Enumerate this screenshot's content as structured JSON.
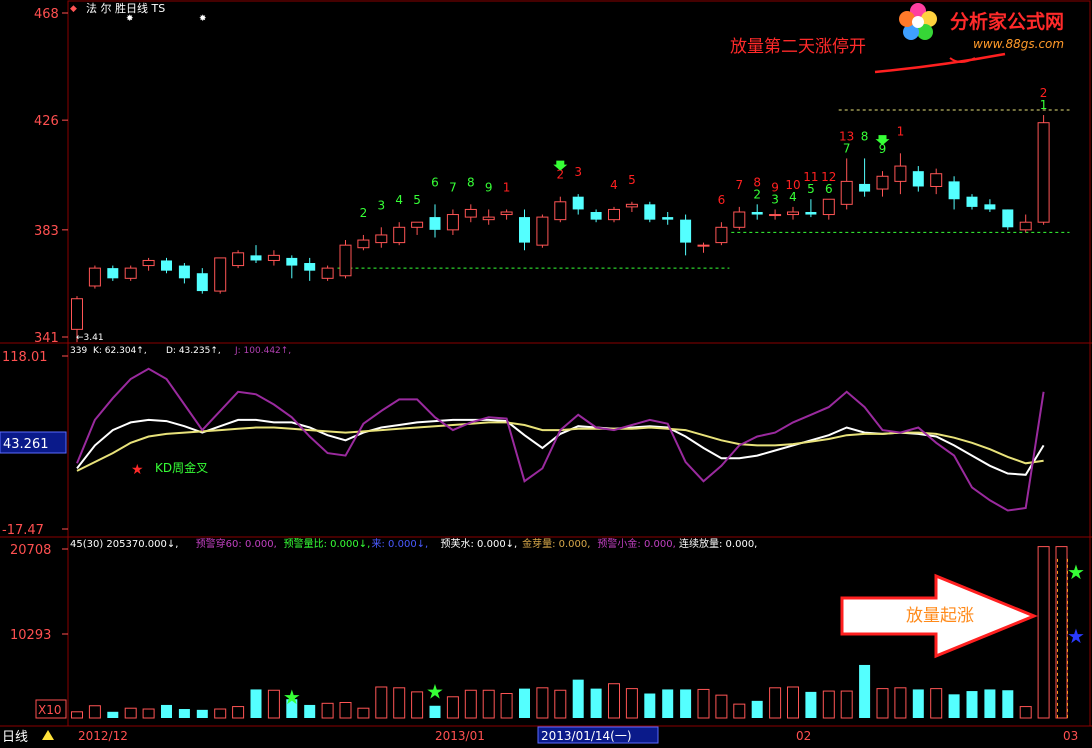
{
  "colors": {
    "up": "#ff5555",
    "down": "#54ffff",
    "white": "#ffffff",
    "yellow": "#e8e27a",
    "purple": "#9a2a9e",
    "green": "#36ff36",
    "red": "#ff2020",
    "grid": "#8a0000",
    "axis": "#ff5050"
  },
  "header": {
    "icon": "◆",
    "title": "法 尔 胜日线 TS"
  },
  "watermark": {
    "site": "分析家公式网",
    "url": "www.88gs.com"
  },
  "annotations": {
    "top_note": "放量第二天涨停开",
    "kd_note": "KD周金叉",
    "vol_note": "放量起涨"
  },
  "footer": {
    "period_label": "日线",
    "x_labels": [
      "2012/12",
      "2013/01",
      "2013/01/14(一)",
      "02",
      "03"
    ],
    "volume_scale": "X10"
  },
  "chart_data": [
    {
      "type": "candlestick",
      "panel": "price",
      "ylim": [
        341,
        468
      ],
      "yticks": [
        468,
        426,
        383,
        341
      ],
      "min_label": "←3.41",
      "candles": [
        {
          "o": 344,
          "h": 357,
          "l": 339,
          "c": 356
        },
        {
          "o": 361,
          "h": 369,
          "l": 360,
          "c": 368
        },
        {
          "o": 368,
          "h": 369,
          "l": 363,
          "c": 364
        },
        {
          "o": 364,
          "h": 369,
          "l": 363,
          "c": 368
        },
        {
          "o": 369,
          "h": 372,
          "l": 367,
          "c": 371
        },
        {
          "o": 371,
          "h": 372,
          "l": 366,
          "c": 367
        },
        {
          "o": 369,
          "h": 370,
          "l": 362,
          "c": 364
        },
        {
          "o": 366,
          "h": 368,
          "l": 358,
          "c": 359
        },
        {
          "o": 359,
          "h": 372,
          "l": 358,
          "c": 372
        },
        {
          "o": 369,
          "h": 375,
          "l": 368,
          "c": 374
        },
        {
          "o": 373,
          "h": 377,
          "l": 370,
          "c": 371
        },
        {
          "o": 371,
          "h": 375,
          "l": 369,
          "c": 373
        },
        {
          "o": 372,
          "h": 373,
          "l": 364,
          "c": 369
        },
        {
          "o": 370,
          "h": 372,
          "l": 363,
          "c": 367
        },
        {
          "o": 364,
          "h": 369,
          "l": 363,
          "c": 368
        },
        {
          "o": 365,
          "h": 379,
          "l": 364,
          "c": 377
        },
        {
          "o": 376,
          "h": 381,
          "l": 375,
          "c": 379
        },
        {
          "o": 378,
          "h": 384,
          "l": 376,
          "c": 381
        },
        {
          "o": 378,
          "h": 386,
          "l": 377,
          "c": 384
        },
        {
          "o": 384,
          "h": 386,
          "l": 381,
          "c": 386
        },
        {
          "o": 388,
          "h": 393,
          "l": 380,
          "c": 383
        },
        {
          "o": 383,
          "h": 391,
          "l": 381,
          "c": 389
        },
        {
          "o": 388,
          "h": 393,
          "l": 386,
          "c": 391
        },
        {
          "o": 387,
          "h": 391,
          "l": 385,
          "c": 388
        },
        {
          "o": 389,
          "h": 391,
          "l": 387,
          "c": 390
        },
        {
          "o": 388,
          "h": 391,
          "l": 375,
          "c": 378
        },
        {
          "o": 377,
          "h": 389,
          "l": 376,
          "c": 388
        },
        {
          "o": 387,
          "h": 396,
          "l": 386,
          "c": 394
        },
        {
          "o": 396,
          "h": 397,
          "l": 389,
          "c": 391
        },
        {
          "o": 390,
          "h": 391,
          "l": 386,
          "c": 387
        },
        {
          "o": 387,
          "h": 392,
          "l": 386,
          "c": 391
        },
        {
          "o": 392,
          "h": 394,
          "l": 390,
          "c": 393
        },
        {
          "o": 393,
          "h": 394,
          "l": 386,
          "c": 387
        },
        {
          "o": 388,
          "h": 390,
          "l": 385,
          "c": 387
        },
        {
          "o": 387,
          "h": 389,
          "l": 373,
          "c": 378
        },
        {
          "o": 377,
          "h": 378,
          "l": 374,
          "c": 377
        },
        {
          "o": 378,
          "h": 386,
          "l": 377,
          "c": 384
        },
        {
          "o": 384,
          "h": 392,
          "l": 383,
          "c": 390
        },
        {
          "o": 390,
          "h": 393,
          "l": 387,
          "c": 389
        },
        {
          "o": 389,
          "h": 391,
          "l": 387,
          "c": 389
        },
        {
          "o": 389,
          "h": 392,
          "l": 387,
          "c": 390
        },
        {
          "o": 390,
          "h": 395,
          "l": 388,
          "c": 389
        },
        {
          "o": 389,
          "h": 395,
          "l": 387,
          "c": 395
        },
        {
          "o": 393,
          "h": 411,
          "l": 391,
          "c": 402
        },
        {
          "o": 401,
          "h": 411,
          "l": 396,
          "c": 398
        },
        {
          "o": 399,
          "h": 406,
          "l": 396,
          "c": 404
        },
        {
          "o": 402,
          "h": 413,
          "l": 397,
          "c": 408
        },
        {
          "o": 406,
          "h": 408,
          "l": 398,
          "c": 400
        },
        {
          "o": 400,
          "h": 407,
          "l": 397,
          "c": 405
        },
        {
          "o": 402,
          "h": 404,
          "l": 391,
          "c": 395
        },
        {
          "o": 396,
          "h": 397,
          "l": 391,
          "c": 392
        },
        {
          "o": 393,
          "h": 395,
          "l": 390,
          "c": 391
        },
        {
          "o": 391,
          "h": 391,
          "l": 383,
          "c": 384
        },
        {
          "o": 383,
          "h": 389,
          "l": 382,
          "c": 386
        },
        {
          "o": 386,
          "h": 428,
          "l": 385,
          "c": 425
        }
      ],
      "seq_labels": [
        {
          "i": 16,
          "text": "2",
          "color": "green"
        },
        {
          "i": 17,
          "text": "3",
          "color": "green"
        },
        {
          "i": 18,
          "text": "4",
          "color": "green"
        },
        {
          "i": 19,
          "text": "5",
          "color": "green"
        },
        {
          "i": 20,
          "text": "6",
          "color": "green"
        },
        {
          "i": 21,
          "text": "7",
          "color": "green"
        },
        {
          "i": 22,
          "text": "8",
          "color": "green"
        },
        {
          "i": 23,
          "text": "9",
          "color": "green"
        },
        {
          "i": 24,
          "text": "1",
          "color": "red"
        },
        {
          "i": 27,
          "text": "2",
          "color": "red"
        },
        {
          "i": 28,
          "text": "3",
          "color": "red"
        },
        {
          "i": 30,
          "text": "4",
          "color": "red"
        },
        {
          "i": 31,
          "text": "5",
          "color": "red"
        },
        {
          "i": 36,
          "text": "6",
          "color": "red"
        },
        {
          "i": 37,
          "text": "7",
          "color": "red"
        },
        {
          "i": 38,
          "text": "8",
          "color": "red"
        },
        {
          "i": 39,
          "text": "9",
          "color": "red"
        },
        {
          "i": 40,
          "text": "10",
          "color": "red"
        },
        {
          "i": 41,
          "text": "11",
          "color": "red"
        },
        {
          "i": 42,
          "text": "12",
          "color": "red"
        },
        {
          "i": 43,
          "text": "13",
          "color": "red"
        },
        {
          "i": 38,
          "text": "2",
          "color": "green",
          "row": 1
        },
        {
          "i": 39,
          "text": "3",
          "color": "green",
          "row": 1
        },
        {
          "i": 40,
          "text": "4",
          "color": "green",
          "row": 1
        },
        {
          "i": 41,
          "text": "5",
          "color": "green",
          "row": 1
        },
        {
          "i": 42,
          "text": "6",
          "color": "green",
          "row": 1
        },
        {
          "i": 43,
          "text": "7",
          "color": "green",
          "row": 1
        },
        {
          "i": 44,
          "text": "8",
          "color": "green"
        },
        {
          "i": 45,
          "text": "9",
          "color": "green"
        },
        {
          "i": 46,
          "text": "1",
          "color": "red"
        },
        {
          "i": 54,
          "text": "2",
          "color": "red"
        },
        {
          "i": 54,
          "text": "1",
          "color": "green",
          "row": 1
        }
      ],
      "arrows": [
        27,
        45
      ],
      "support_lines": [
        {
          "from": 15,
          "to": 36,
          "y": 368,
          "color": "green"
        },
        {
          "from": 37,
          "to": 55,
          "y": 382,
          "color": "green"
        },
        {
          "from": 43,
          "to": 55,
          "y": 430,
          "color": "yellow"
        }
      ]
    },
    {
      "type": "line",
      "panel": "kdj",
      "ylim": [
        -17.47,
        118.01
      ],
      "yticks": [
        118.01,
        -17.47
      ],
      "current_value": "43.261",
      "legend": {
        "prefix": "339",
        "K": "K: 62.304↑,",
        "D": "D: 43.235↑,",
        "J": "J: 100.442↑,"
      },
      "series": [
        {
          "name": "K",
          "color": "white",
          "values": [
            30,
            48,
            60,
            66,
            68,
            67,
            63,
            58,
            63,
            68,
            68,
            66,
            66,
            62,
            56,
            52,
            58,
            62,
            64,
            66,
            67,
            68,
            68,
            68,
            67,
            56,
            46,
            57,
            63,
            62,
            61,
            62,
            63,
            62,
            55,
            46,
            38,
            38,
            40,
            44,
            48,
            52,
            56,
            62,
            58,
            57,
            58,
            57,
            55,
            48,
            40,
            32,
            26,
            25,
            48
          ]
        },
        {
          "name": "D",
          "color": "yellow",
          "values": [
            28,
            35,
            42,
            50,
            55,
            57,
            58,
            59,
            60,
            61,
            62,
            62,
            61,
            60,
            59,
            58,
            59,
            60,
            61,
            62,
            63,
            64,
            65,
            66,
            66,
            64,
            60,
            60,
            61,
            61,
            61,
            61,
            62,
            61,
            60,
            56,
            52,
            49,
            48,
            48,
            49,
            51,
            53,
            56,
            57,
            57,
            58,
            58,
            57,
            54,
            50,
            45,
            39,
            34,
            36
          ]
        },
        {
          "name": "J",
          "color": "purple",
          "values": [
            34,
            68,
            85,
            100,
            108,
            100,
            80,
            60,
            75,
            90,
            88,
            80,
            70,
            55,
            42,
            40,
            65,
            75,
            84,
            84,
            70,
            60,
            66,
            70,
            69,
            20,
            30,
            60,
            72,
            62,
            60,
            64,
            68,
            65,
            35,
            20,
            32,
            48,
            55,
            58,
            66,
            72,
            78,
            90,
            78,
            60,
            58,
            62,
            50,
            40,
            15,
            5,
            -3,
            -1,
            90
          ]
        }
      ],
      "x0_index": 4,
      "start_index": 0
    },
    {
      "type": "bar",
      "panel": "volume",
      "ylim": [
        0,
        20708
      ],
      "yticks": [
        20708,
        10293
      ],
      "legend": [
        {
          "text": "45(30) 205370.000↓,",
          "color": "white"
        },
        {
          "text": "预警穿60: 0.000,",
          "color": "purple"
        },
        {
          "text": "预警量比: 0.000↓,",
          "color": "green"
        },
        {
          "text": "来: 0.000↓,",
          "color": "blue"
        },
        {
          "text": "预芙水: 0.000↓,",
          "color": "white"
        },
        {
          "text": "金芽量: 0.000,",
          "color": "yellow"
        },
        {
          "text": "预警小金: 0.000,",
          "color": "purple"
        },
        {
          "text": "连续放量: 0.000,",
          "color": "white"
        }
      ],
      "values": [
        760,
        1500,
        760,
        1200,
        1100,
        1600,
        1100,
        1000,
        1100,
        1400,
        3500,
        3400,
        2300,
        1600,
        1800,
        1900,
        1200,
        3800,
        3700,
        3200,
        1500,
        2600,
        3400,
        3400,
        3000,
        3600,
        3700,
        3400,
        4700,
        3600,
        4200,
        3600,
        3000,
        3500,
        3500,
        3500,
        2800,
        1700,
        2100,
        3700,
        3800,
        3200,
        3300,
        3300,
        6500,
        3600,
        3700,
        3500,
        3600,
        2900,
        3300,
        3500,
        3400,
        1400,
        21000,
        21000
      ],
      "stars": [
        {
          "i": 12,
          "v": 2700,
          "color": "green"
        },
        {
          "i": 20,
          "v": 3400,
          "color": "green"
        },
        {
          "i": 57,
          "v": 18000,
          "color": "green"
        },
        {
          "i": 57,
          "v": 10200,
          "color": "blue"
        }
      ]
    }
  ]
}
